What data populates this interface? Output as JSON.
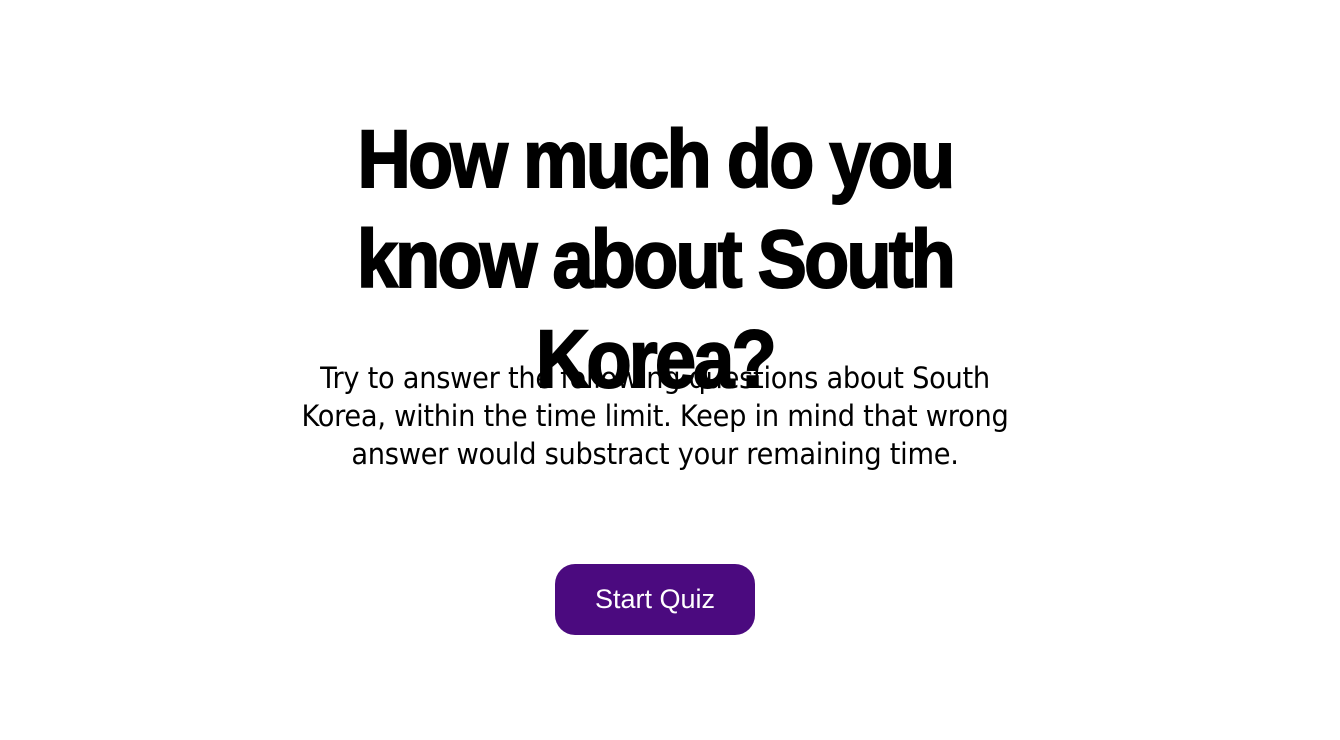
{
  "intro": {
    "title": "How much do you know about South Korea?",
    "description": "Try to answer the following questions about South Korea, within the time limit. Keep in mind that wrong answer would substract your remaining time.",
    "start_button_label": "Start Quiz"
  },
  "colors": {
    "button_background": "#4b0a7f",
    "button_text": "#ffffff",
    "page_background": "#ffffff"
  }
}
